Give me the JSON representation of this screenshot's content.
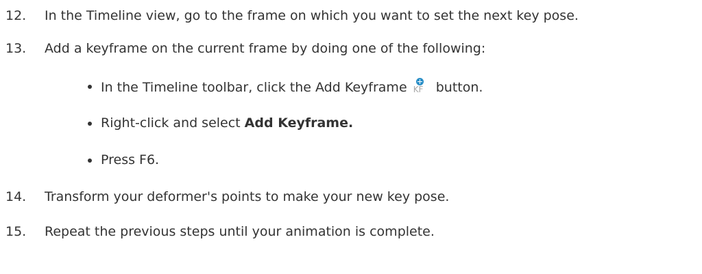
{
  "steps": [
    {
      "number": "12.",
      "text": "In the Timeline view, go to the frame on which you want to set the next key pose."
    },
    {
      "number": "13.",
      "text": "Add a keyframe on the current frame by doing one of the following:"
    },
    {
      "number": "14.",
      "text": "Transform your deformer's points to make your new key pose."
    },
    {
      "number": "15.",
      "text": "Repeat the previous steps until your animation is complete."
    }
  ],
  "substeps": {
    "toolbar": {
      "before": "In the Timeline toolbar, click the Add Keyframe",
      "icon": "add-keyframe-icon",
      "icon_label": "KF",
      "after": "button."
    },
    "rightclick": {
      "before": "Right-click and select ",
      "bold": "Add Keyframe."
    },
    "press": {
      "text": "Press F6."
    }
  },
  "colors": {
    "text": "#333333",
    "icon_accent": "#2b8fc7",
    "icon_label": "#a7a7a7"
  }
}
